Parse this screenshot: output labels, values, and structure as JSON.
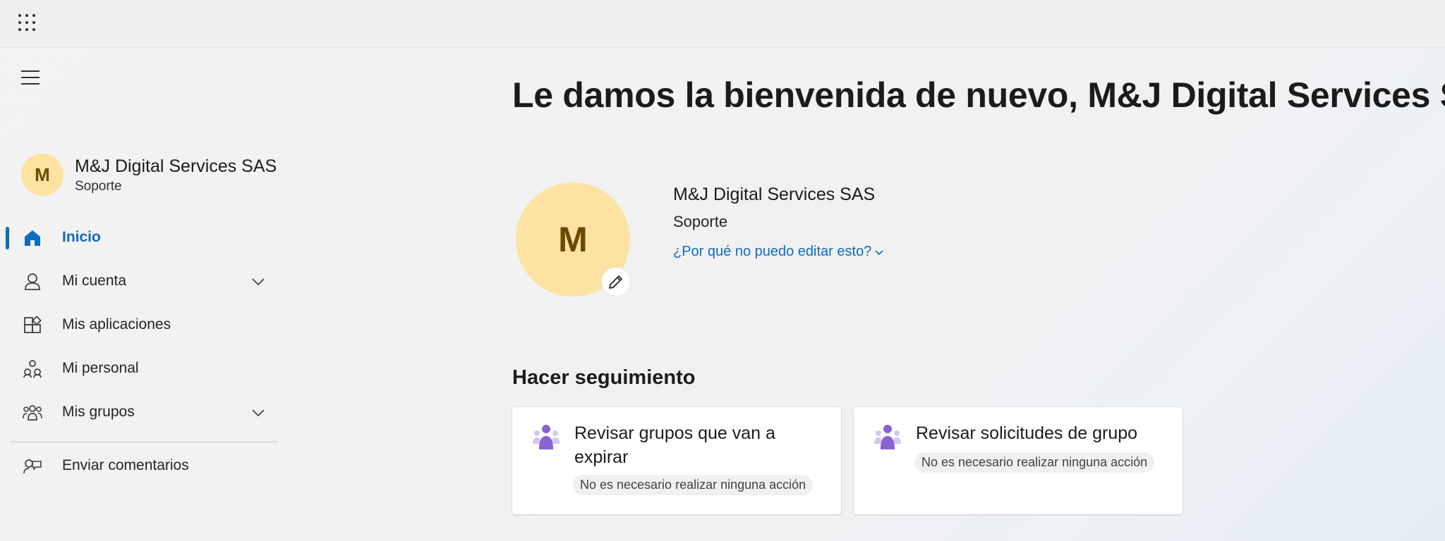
{
  "header": {
    "app_launcher_icon": "waffle-icon"
  },
  "sidebar": {
    "menu_icon": "hamburger-icon",
    "profile": {
      "initial": "M",
      "name": "M&J Digital Services SAS",
      "role": "Soporte"
    },
    "items": [
      {
        "label": "Inicio",
        "icon": "home-icon",
        "active": true
      },
      {
        "label": "Mi cuenta",
        "icon": "person-icon",
        "expandable": true
      },
      {
        "label": "Mis aplicaciones",
        "icon": "apps-icon"
      },
      {
        "label": "Mi personal",
        "icon": "people-icon"
      },
      {
        "label": "Mis grupos",
        "icon": "groups-icon",
        "expandable": true
      },
      {
        "label": "Enviar comentarios",
        "icon": "feedback-icon"
      }
    ]
  },
  "main": {
    "welcome": "Le damos la bienvenida de nuevo, M&J Digital Services SAS",
    "profile": {
      "initial": "M",
      "name": "M&J Digital Services SAS",
      "role": "Soporte",
      "edit_link": "¿Por qué no puedo editar esto?"
    },
    "section_title": "Hacer seguimiento",
    "cards": [
      {
        "title": "Revisar grupos que van a expirar",
        "status": "No es necesario realizar ninguna acción",
        "icon": "group-review-icon"
      },
      {
        "title": "Revisar solicitudes de grupo",
        "status": "No es necesario realizar ninguna acción",
        "icon": "group-requests-icon"
      }
    ]
  },
  "colors": {
    "accent": "#0f6cbd",
    "avatar_bg": "#fde3a2",
    "avatar_fg": "#6b4a00",
    "card_icon": "#8a63d2"
  }
}
